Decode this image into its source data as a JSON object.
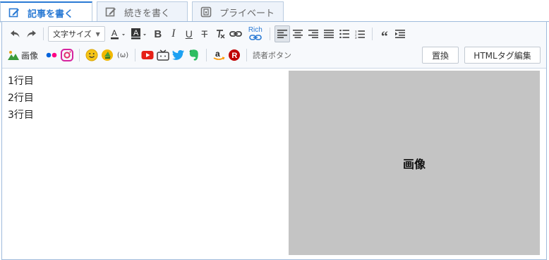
{
  "tabs": [
    {
      "label": "記事を書く",
      "icon": "edit-icon",
      "active": true
    },
    {
      "label": "続きを書く",
      "icon": "edit-icon",
      "active": false
    },
    {
      "label": "プライベート",
      "icon": "private-icon",
      "active": false
    }
  ],
  "toolbar": {
    "font_size_select": "文字サイズ",
    "rich_link_label": "Rich",
    "image_label": "画像",
    "reader_button_label": "読者ボタン",
    "replace_button": "置換",
    "html_edit_button": "HTMLタグ編集"
  },
  "editor": {
    "lines": [
      "1行目",
      "2行目",
      "3行目"
    ]
  },
  "preview": {
    "label": "画像"
  },
  "colors": {
    "accent": "#2a7ad4",
    "youtube": "#e62117",
    "twitter": "#1da1f2",
    "evernote": "#2dbe60",
    "rakuten": "#bf0000",
    "amazon_smile": "#ff9900"
  }
}
